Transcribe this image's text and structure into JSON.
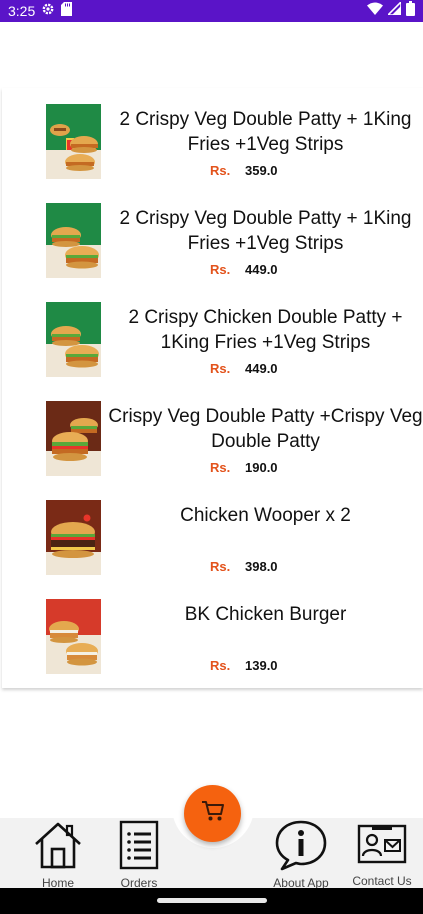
{
  "status_bar": {
    "time": "3:25",
    "left_icons": [
      "settings-icon",
      "sd-card-icon"
    ],
    "right_icons": [
      "wifi-icon",
      "signal-icon",
      "battery-icon"
    ],
    "color": "#5a14c8"
  },
  "accent_color": "#e3531c",
  "menu": {
    "items": [
      {
        "name": "2 Crispy Veg Double Patty + 1King Fries +1Veg Strips",
        "currency": "Rs.",
        "price": "359.0",
        "image": "combo-meal-image"
      },
      {
        "name": "2 Crispy Veg Double Patty + 1King Fries +1Veg Strips",
        "currency": "Rs.",
        "price": "449.0",
        "image": "double-burger-image"
      },
      {
        "name": "2 Crispy Chicken Double Patty + 1King Fries +1Veg Strips",
        "currency": "Rs.",
        "price": "449.0",
        "image": "double-burger-image"
      },
      {
        "name": "Crispy Veg Double Patty +Crispy Veg Double Patty",
        "currency": "Rs.",
        "price": "190.0",
        "image": "veg-burger-image"
      },
      {
        "name": "Chicken Wooper x 2",
        "currency": "Rs.",
        "price": "398.0",
        "image": "whopper-image"
      },
      {
        "name": "BK Chicken Burger",
        "currency": "Rs.",
        "price": "139.0",
        "image": "chicken-burger-image"
      }
    ]
  },
  "fab": {
    "icon": "cart-icon",
    "color": "#f5620f"
  },
  "bottom_nav": {
    "home": {
      "label": "Home",
      "icon": "home-icon"
    },
    "orders": {
      "label": "Orders",
      "icon": "orders-icon"
    },
    "about": {
      "label": "About App",
      "icon": "info-icon"
    },
    "contact": {
      "label": "Contact Us",
      "icon": "contact-icon"
    }
  }
}
